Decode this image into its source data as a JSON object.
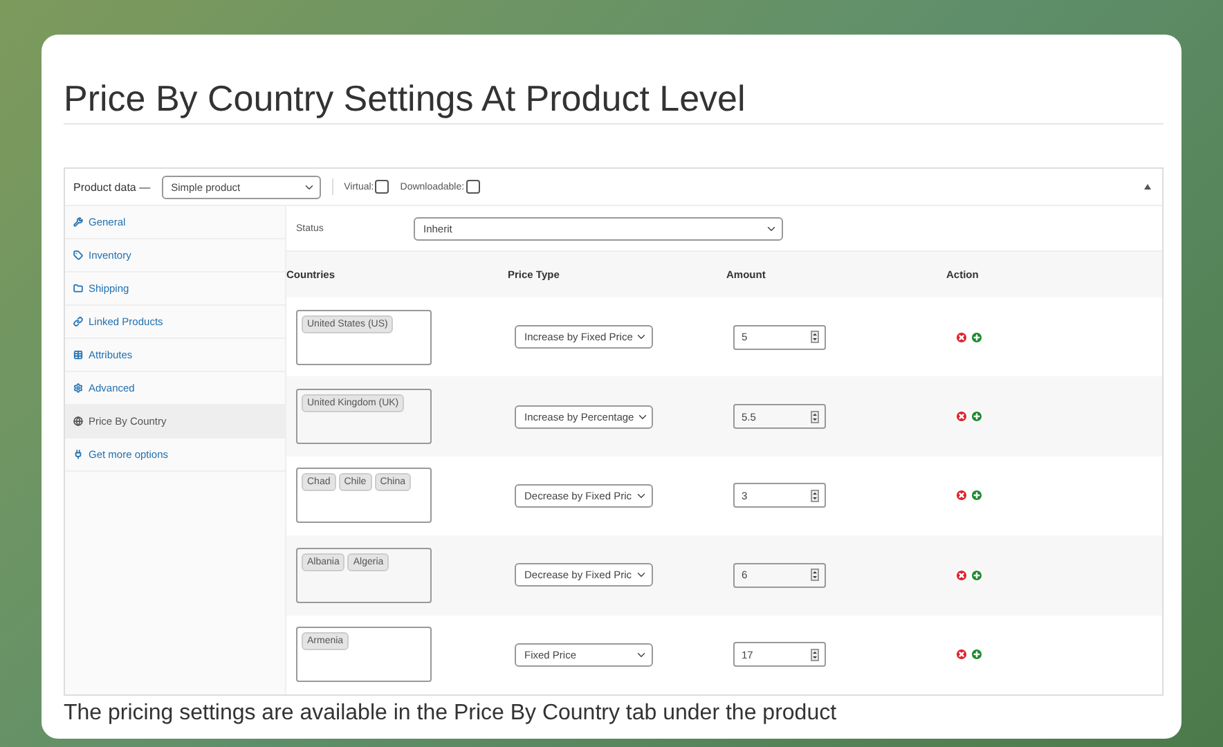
{
  "title": "Price By Country Settings At Product Level",
  "product_data": {
    "label": "Product data —",
    "type": "Simple product",
    "options": [
      {
        "label": "Virtual:",
        "checked": false
      },
      {
        "label": "Downloadable:",
        "checked": false
      }
    ]
  },
  "tabs": [
    {
      "kind": "general",
      "label": "General",
      "selected": false
    },
    {
      "kind": "inventory",
      "label": "Inventory",
      "selected": false
    },
    {
      "kind": "shipping",
      "label": "Shipping",
      "selected": false
    },
    {
      "kind": "linked",
      "label": "Linked Products",
      "selected": false
    },
    {
      "kind": "attributes",
      "label": "Attributes",
      "selected": false
    },
    {
      "kind": "advanced",
      "label": "Advanced",
      "selected": false
    },
    {
      "kind": "country",
      "label": "Price By Country",
      "selected": true
    },
    {
      "kind": "more",
      "label": "Get more options",
      "selected": false
    }
  ],
  "status": {
    "label": "Status",
    "value": "Inherit"
  },
  "columns": [
    "Countries",
    "Price Type",
    "Amount",
    "Action"
  ],
  "rows": [
    {
      "countries": [
        "United States (US)"
      ],
      "price_type": "Increase by Fixed Price",
      "amount": "5"
    },
    {
      "countries": [
        "United Kingdom (UK)"
      ],
      "price_type": "Increase by Percentage",
      "amount": "5.5"
    },
    {
      "countries": [
        "Chad",
        "Chile",
        "China"
      ],
      "price_type": "Decrease by Fixed Pric",
      "amount": "3"
    },
    {
      "countries": [
        "Albania",
        "Algeria"
      ],
      "price_type": "Decrease by Fixed Pric",
      "amount": "6"
    },
    {
      "countries": [
        "Armenia"
      ],
      "price_type": "Fixed Price",
      "amount": "17"
    }
  ],
  "caption": "The pricing settings are available in the Price By Country tab under the product"
}
